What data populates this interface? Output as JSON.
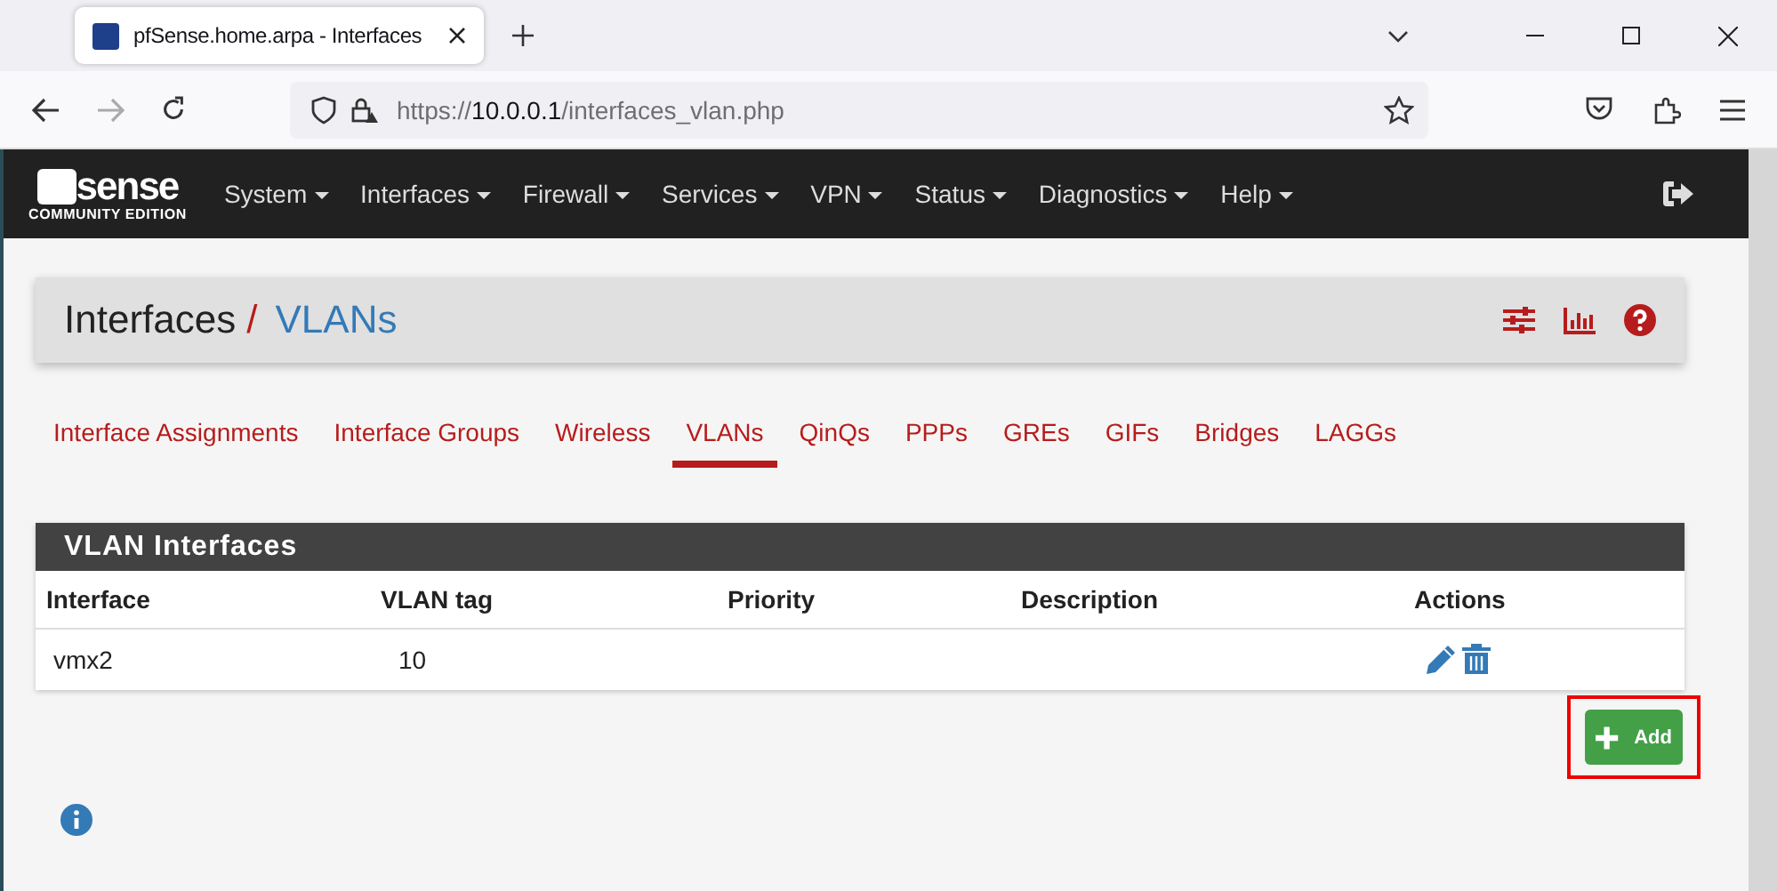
{
  "browser": {
    "tab_title": "pfSense.home.arpa - Interfaces",
    "url_scheme": "https://",
    "url_host": "10.0.0.1",
    "url_path": "/interfaces_vlan.php"
  },
  "navbar": {
    "logo_main": "sense",
    "logo_sub": "COMMUNITY EDITION",
    "menus": [
      "System",
      "Interfaces",
      "Firewall",
      "Services",
      "VPN",
      "Status",
      "Diagnostics",
      "Help"
    ]
  },
  "breadcrumb": {
    "parent": "Interfaces",
    "separator": "/",
    "current": "VLANs"
  },
  "tabs": [
    {
      "label": "Interface Assignments",
      "selected": false
    },
    {
      "label": "Interface Groups",
      "selected": false
    },
    {
      "label": "Wireless",
      "selected": false
    },
    {
      "label": "VLANs",
      "selected": true
    },
    {
      "label": "QinQs",
      "selected": false
    },
    {
      "label": "PPPs",
      "selected": false
    },
    {
      "label": "GREs",
      "selected": false
    },
    {
      "label": "GIFs",
      "selected": false
    },
    {
      "label": "Bridges",
      "selected": false
    },
    {
      "label": "LAGGs",
      "selected": false
    }
  ],
  "panel": {
    "title": "VLAN Interfaces",
    "columns": [
      "Interface",
      "VLAN tag",
      "Priority",
      "Description",
      "Actions"
    ],
    "rows": [
      {
        "interface": "vmx2",
        "vlan_tag": "10"
      }
    ]
  },
  "add_button": {
    "label": "Add",
    "highlighted": true
  }
}
